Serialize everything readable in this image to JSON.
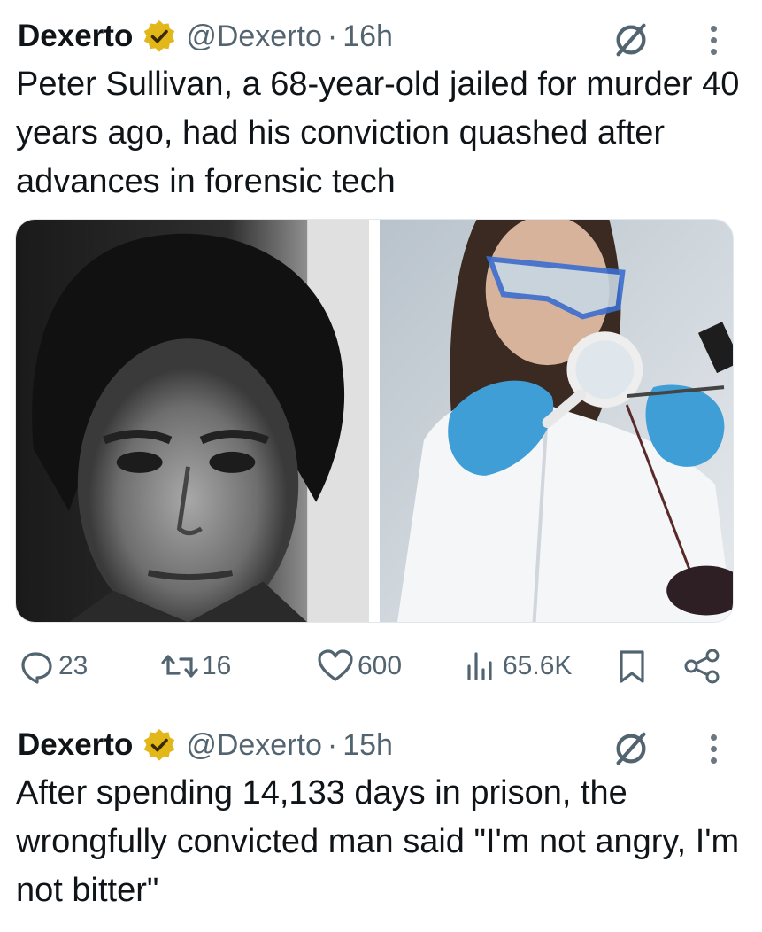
{
  "tweets": [
    {
      "author_name": "Dexerto",
      "handle": "@Dexerto",
      "separator": "·",
      "time": "16h",
      "text": "Peter Sullivan, a 68-year-old jailed for murder 40 years ago, had his conviction quashed after advances in forensic tech",
      "media": [
        {
          "icon": "bw-mugshot-photo"
        },
        {
          "icon": "forensic-scientist-photo"
        }
      ],
      "actions": {
        "replies": "23",
        "reposts": "16",
        "likes": "600",
        "views": "65.6K"
      }
    },
    {
      "author_name": "Dexerto",
      "handle": "@Dexerto",
      "separator": "·",
      "time": "15h",
      "text": "After spending 14,133 days in prison, the wrongfully convicted man said \"I'm not angry, I'm not bitter\""
    }
  ],
  "colors": {
    "text_primary": "#0f1419",
    "text_secondary": "#536471",
    "verified_gold": "#e2b719"
  }
}
